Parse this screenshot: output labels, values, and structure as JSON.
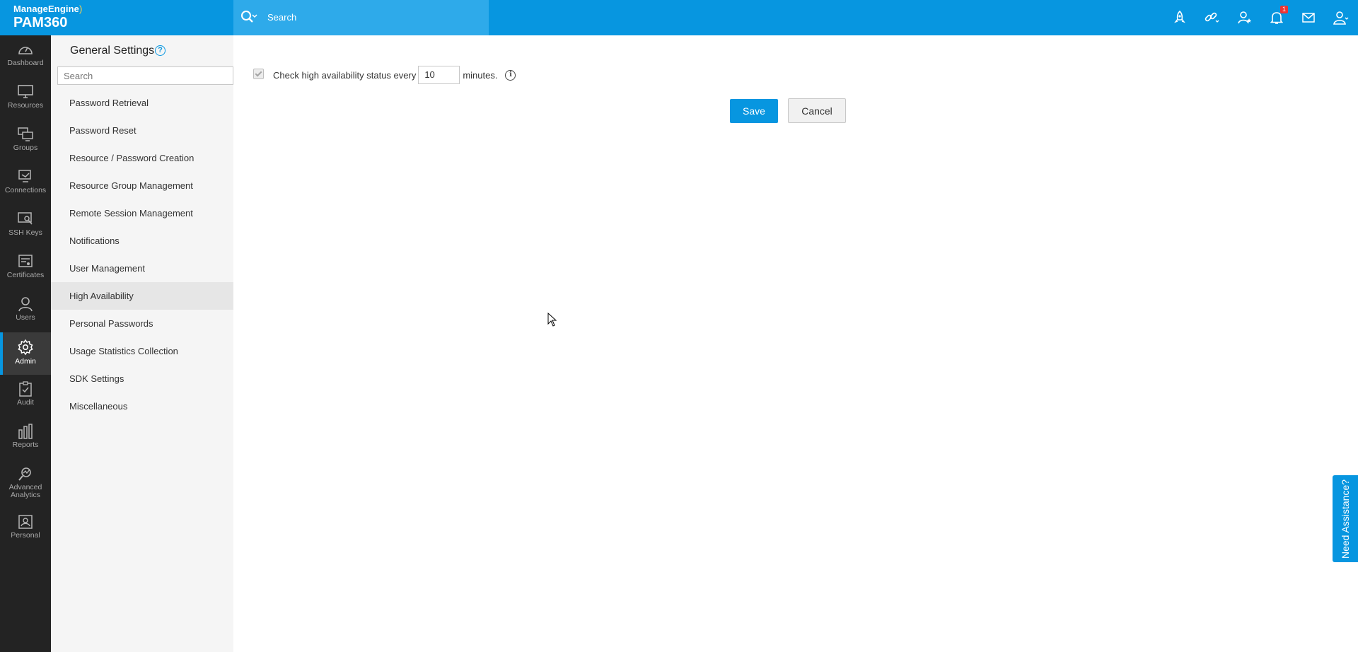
{
  "header": {
    "brand_top": "ManageEngine",
    "brand_product": "PAM360",
    "search_placeholder": "Search",
    "notification_count": "1",
    "icons": [
      "rocket-icon",
      "link-icon",
      "user-star-icon",
      "bell-icon",
      "mail-icon",
      "user-icon"
    ]
  },
  "left_nav": {
    "items": [
      {
        "label": "Dashboard",
        "icon": "dashboard-icon"
      },
      {
        "label": "Resources",
        "icon": "monitor-icon"
      },
      {
        "label": "Groups",
        "icon": "groups-icon"
      },
      {
        "label": "Connections",
        "icon": "connections-icon"
      },
      {
        "label": "SSH Keys",
        "icon": "ssh-key-icon"
      },
      {
        "label": "Certificates",
        "icon": "certificate-icon"
      },
      {
        "label": "Users",
        "icon": "user-icon"
      },
      {
        "label": "Admin",
        "icon": "gear-icon",
        "active": true
      },
      {
        "label": "Audit",
        "icon": "clipboard-icon"
      },
      {
        "label": "Reports",
        "icon": "bar-chart-icon"
      },
      {
        "label_line1": "Advanced",
        "label_line2": "Analytics",
        "icon": "analytics-icon"
      },
      {
        "label": "Personal",
        "icon": "personal-icon"
      }
    ]
  },
  "settings_sidebar": {
    "title": "General Settings",
    "search_placeholder": "Search",
    "items": [
      {
        "label": "Password Retrieval"
      },
      {
        "label": "Password Reset"
      },
      {
        "label": "Resource / Password Creation"
      },
      {
        "label": "Resource Group Management"
      },
      {
        "label": "Remote Session Management"
      },
      {
        "label": "Notifications"
      },
      {
        "label": "User Management"
      },
      {
        "label": "High Availability",
        "selected": true
      },
      {
        "label": "Personal Passwords"
      },
      {
        "label": "Usage Statistics Collection"
      },
      {
        "label": "SDK Settings"
      },
      {
        "label": "Miscellaneous"
      }
    ]
  },
  "main": {
    "check_label": "Check high availability status every",
    "interval_value": "10",
    "interval_unit": "minutes.",
    "checkbox_checked": true,
    "save_label": "Save",
    "cancel_label": "Cancel"
  },
  "assist_label": "Need Assistance?",
  "colors": {
    "accent": "#0796e0",
    "nav_bg": "#232323",
    "sidebar_bg": "#f5f5f5"
  }
}
